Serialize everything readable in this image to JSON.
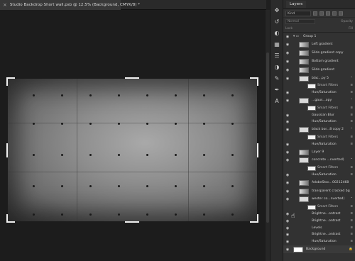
{
  "document": {
    "tab_title": "Studio Backdrop Short wall.psb @ 12.5% (Background, CMYK/8) *",
    "close_glyph": "×"
  },
  "panel": {
    "tab": "Layers",
    "filter_kind": "Kind",
    "blend_mode": "Normal",
    "opacity_label": "Opacity",
    "lock_label": "Lock",
    "fill_label": "Fill"
  },
  "layers": [
    {
      "name": "Group 1",
      "kind": "group",
      "indent": 0
    },
    {
      "name": "Left gradient",
      "kind": "layer",
      "indent": 1
    },
    {
      "name": "Slide gradient copy",
      "kind": "layer",
      "indent": 1
    },
    {
      "name": "Bottom gradient",
      "kind": "layer",
      "indent": 1
    },
    {
      "name": "Slide gradient",
      "kind": "layer",
      "indent": 1
    },
    {
      "name": "blac...py 5",
      "kind": "smart",
      "indent": 1,
      "fx": "⌃"
    },
    {
      "name": "Smart Filters",
      "kind": "filter-head",
      "indent": 2
    },
    {
      "name": "Hue/Saturation",
      "kind": "filter",
      "indent": 2
    },
    {
      "name": "...gaus...opy",
      "kind": "smart",
      "indent": 1,
      "fx": "⌃"
    },
    {
      "name": "Smart Filters",
      "kind": "filter-head",
      "indent": 2
    },
    {
      "name": "Gaussian Blur",
      "kind": "filter",
      "indent": 2
    },
    {
      "name": "Hue/Saturation",
      "kind": "filter",
      "indent": 2
    },
    {
      "name": "black bor...8 copy 2",
      "kind": "smart",
      "indent": 1,
      "fx": "⌃"
    },
    {
      "name": "Smart Filters",
      "kind": "filter-head",
      "indent": 2
    },
    {
      "name": "Hue/Saturation",
      "kind": "filter",
      "indent": 2
    },
    {
      "name": "Layer 9",
      "kind": "layer",
      "indent": 1
    },
    {
      "name": "concrete ...nverted)",
      "kind": "smart",
      "indent": 1,
      "fx": "⌃"
    },
    {
      "name": "Smart Filters",
      "kind": "filter-head",
      "indent": 2
    },
    {
      "name": "Hue/Saturation",
      "kind": "filter",
      "indent": 2
    },
    {
      "name": "AdobeStoc...00212468",
      "kind": "layer",
      "indent": 1
    },
    {
      "name": "transparent cracked bg",
      "kind": "layer",
      "indent": 1
    },
    {
      "name": "wester co...nverted)",
      "kind": "smart",
      "indent": 1,
      "fx": "⌃"
    },
    {
      "name": "Smart Filters",
      "kind": "filter-head",
      "indent": 2
    },
    {
      "name": "Brightne...ontrast",
      "kind": "filter",
      "indent": 2
    },
    {
      "name": "Brightne...ontrast",
      "kind": "filter",
      "indent": 2
    },
    {
      "name": "Levels",
      "kind": "filter",
      "indent": 2
    },
    {
      "name": "Brightne...ontrast",
      "kind": "filter",
      "indent": 2
    },
    {
      "name": "Hue/Saturation",
      "kind": "filter",
      "indent": 2
    },
    {
      "name": "Background",
      "kind": "background",
      "indent": 0
    }
  ],
  "icons": [
    "move-tool-icon",
    "history-icon",
    "color-icon",
    "swatches-icon",
    "properties-icon",
    "adjustments-icon",
    "brush-icon",
    "paths-icon",
    "character-icon"
  ]
}
